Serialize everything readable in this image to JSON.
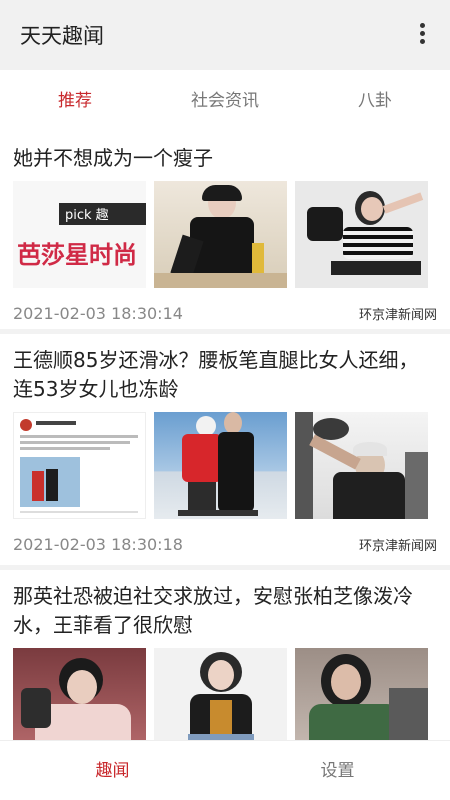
{
  "app": {
    "title": "天天趣闻"
  },
  "tabs": [
    {
      "label": "推荐",
      "active": true
    },
    {
      "label": "社会资讯",
      "active": false
    },
    {
      "label": "八卦",
      "active": false
    }
  ],
  "feed": [
    {
      "title": "她并不想成为一个瘦子",
      "time": "2021-02-03 18:30:14",
      "source": "环京津新闻网",
      "images": [
        "fashion-magazine-banner",
        "woman-black-outfit",
        "woman-reclining-stripes"
      ],
      "banner_text": "芭莎星时尚",
      "banner_tag": "pick 趣"
    },
    {
      "title": "王德顺85岁还滑冰？腰板笔直腿比女人还细，连53岁女儿也冻龄",
      "time": "2021-02-03 18:30:18",
      "source": "环京津新闻网",
      "images": [
        "social-post-screenshot",
        "couple-on-ice",
        "elderly-man-gym"
      ]
    },
    {
      "title": "那英社恐被迫社交求放过，安慰张柏芝像泼冷水，王菲看了很欣慰",
      "time": "",
      "source": "",
      "images": [
        "woman-pink-jacket",
        "woman-leather-jacket",
        "woman-green-outfit"
      ]
    }
  ],
  "bottom_nav": [
    {
      "label": "趣闻",
      "active": true
    },
    {
      "label": "设置",
      "active": false
    }
  ],
  "colors": {
    "accent": "#c8282c",
    "appbar_bg": "#f1f1f1"
  }
}
